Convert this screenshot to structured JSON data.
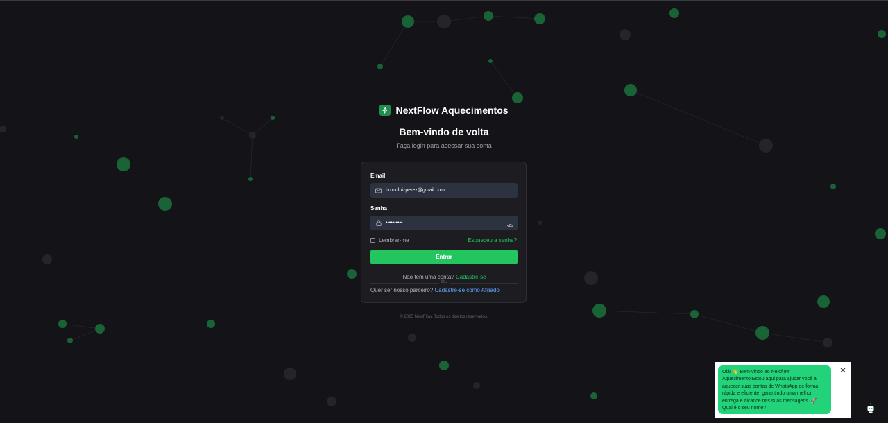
{
  "brand": {
    "name": "NextFlow Aquecimentos",
    "icon": "lightning-icon",
    "accent": "#22c55e"
  },
  "header": {
    "title": "Bem-vindo de volta",
    "subtitle": "Faça login para acessar sua conta"
  },
  "form": {
    "email_label": "Email",
    "email_value": "brunoluizperez@gmail.com",
    "email_icon": "mail-icon",
    "password_label": "Senha",
    "password_value": "••••••••••",
    "password_icon": "lock-icon",
    "toggle_icon": "eye-icon",
    "remember_label": "Lembrar-me",
    "forgot_label": "Esqueceu a senha?",
    "submit_label": "Entrar",
    "signup_prompt": "Não tem uma conta?",
    "signup_link": "Cadastre-se",
    "divider_label": "OU",
    "affiliate_prompt": "Quer ser nosso parceiro?",
    "affiliate_link": "Cadastre-se como Afiliado"
  },
  "footer": {
    "copyright": "© 2025 NextFlow. Todos os direitos reservados."
  },
  "chat": {
    "message": "Olá! 👋 Bem-vindo ao Nextflow Aquecimento!Estou aqui para ajudar você a aquecer suas contas de WhatsApp de forma rápida e eficiente, garantindo uma melhor entrega e alcance nas suas mensagens. 🚀 Qual é o seu nome?",
    "close_label": "✕",
    "bubble_color": "#22d37a"
  }
}
